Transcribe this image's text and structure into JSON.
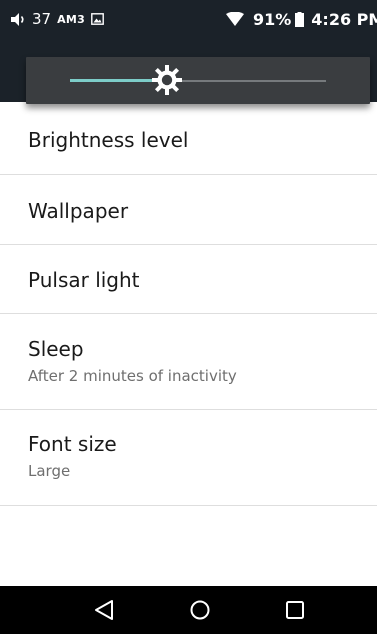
{
  "status_bar": {
    "volume_level": "37",
    "carrier_label": "AM3",
    "battery_percent": "91%",
    "time": "4:26 PM",
    "icons": [
      "speaker-icon",
      "image-icon",
      "wifi-icon",
      "battery-icon"
    ]
  },
  "brightness_slider": {
    "level": 0.38,
    "accent_color": "#7dcdc9",
    "icon": "brightness-sun-icon"
  },
  "settings": {
    "items": [
      {
        "title": "Brightness level",
        "subtitle": ""
      },
      {
        "title": "Wallpaper",
        "subtitle": ""
      },
      {
        "title": "Pulsar light",
        "subtitle": ""
      },
      {
        "title": "Sleep",
        "subtitle": "After 2 minutes of inactivity"
      },
      {
        "title": "Font size",
        "subtitle": "Large"
      }
    ]
  },
  "nav_bar": {
    "icons": [
      "back-icon",
      "home-icon",
      "recent-apps-icon"
    ]
  }
}
